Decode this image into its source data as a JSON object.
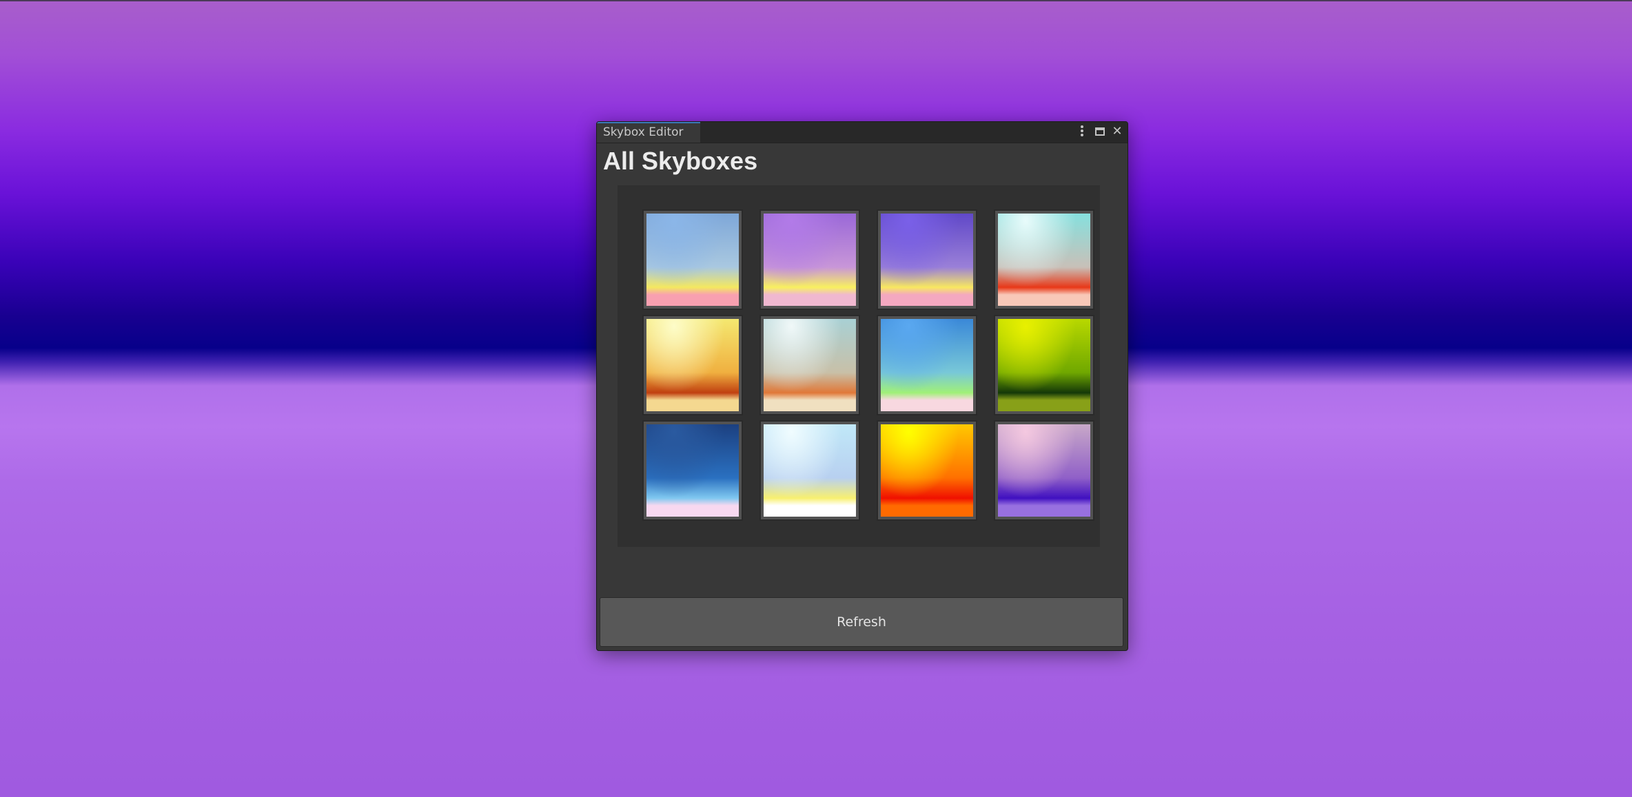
{
  "window": {
    "tab_title": "Skybox Editor",
    "icons": [
      "menu-icon",
      "maximize-icon",
      "close-icon"
    ]
  },
  "main": {
    "title": "All Skyboxes",
    "refresh_label": "Refresh"
  },
  "skyboxes": [
    {
      "colors": [
        "#8bb6e8",
        "#7ea7d8",
        "#a9c8e0",
        "#f4e860",
        "#f8a0b0"
      ]
    },
    {
      "colors": [
        "#b27be8",
        "#9a68d8",
        "#c896d8",
        "#f8f060",
        "#f0b8d0"
      ]
    },
    {
      "colors": [
        "#7a60e8",
        "#6048c8",
        "#9a80d8",
        "#f8e860",
        "#f4a8c0"
      ]
    },
    {
      "colors": [
        "#e8fbfb",
        "#86e0de",
        "#c8c0b8",
        "#e83818",
        "#f8c8b8"
      ]
    },
    {
      "colors": [
        "#fdfcc8",
        "#f4e870",
        "#f0b040",
        "#c04010",
        "#f4d890"
      ]
    },
    {
      "colors": [
        "#f0f8f8",
        "#a8d0d4",
        "#c8c0a8",
        "#e07838",
        "#f0e0c0"
      ]
    },
    {
      "colors": [
        "#5aa8f0",
        "#3a88d8",
        "#78c8d8",
        "#a0f078",
        "#f8d8e0"
      ]
    },
    {
      "colors": [
        "#e8f000",
        "#b8d800",
        "#70a800",
        "#143808",
        "#88a018"
      ]
    },
    {
      "colors": [
        "#2a5aa0",
        "#1c4080",
        "#2a70c0",
        "#80c8f0",
        "#f8d8f0"
      ]
    },
    {
      "colors": [
        "#f0fcff",
        "#c0e8f8",
        "#b8d0f0",
        "#f8f070",
        "#ffffff"
      ]
    },
    {
      "colors": [
        "#ffff00",
        "#ffc800",
        "#ff7000",
        "#f01000",
        "#ff6a00"
      ]
    },
    {
      "colors": [
        "#f4c8e0",
        "#c8a8c8",
        "#9060c8",
        "#4010c0",
        "#9870e0"
      ]
    }
  ],
  "scene": {
    "sky_colors": [
      "#a85ecb",
      "#8a2be0",
      "#3a02b8",
      "#07008a"
    ],
    "ground_colors": [
      "#b070ea",
      "#a05ae0"
    ]
  }
}
